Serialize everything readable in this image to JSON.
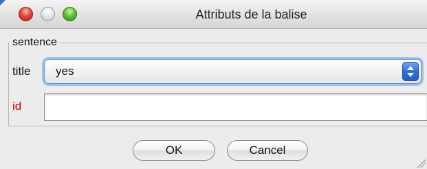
{
  "window": {
    "title": "Attributs de la balise"
  },
  "fieldset": {
    "legend": "sentence",
    "fields": {
      "title": {
        "label": "title",
        "selected_value": "yes"
      },
      "id": {
        "label": "id",
        "value": "",
        "label_color": "#d00000"
      }
    }
  },
  "buttons": {
    "ok_label": "OK",
    "cancel_label": "Cancel"
  },
  "icons": {
    "close": "close-button-icon",
    "minimize": "minimize-button-icon",
    "zoom": "zoom-button-icon",
    "select_arrows": "up-down-arrows-icon",
    "resize": "resize-grip-icon"
  },
  "colors": {
    "focus_ring": "#9fc0ef",
    "select_arrow_bg": "#2f6fd8",
    "required_label": "#d00000"
  }
}
